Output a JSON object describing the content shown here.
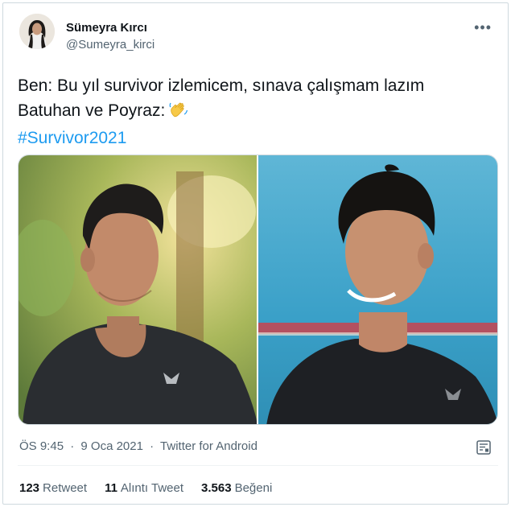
{
  "author": {
    "display_name": "Sümeyra Kırcı",
    "handle": "@Sumeyra_kirci"
  },
  "menu": {
    "more_icon": "more-horizontal-icon"
  },
  "tweet": {
    "line1": "Ben: Bu yıl survivor izlemicem, sınava çalışmam lazım",
    "line2": "Batuhan ve Poyraz:",
    "emoji": "waving-hand",
    "hashtag": "#Survivor2021"
  },
  "media": {
    "images": [
      "photo-left",
      "photo-right"
    ]
  },
  "meta": {
    "time": "ÖS 9:45",
    "separator": "·",
    "date": "9 Oca 2021",
    "source": "Twitter for Android",
    "analytics_icon": "analytics-icon"
  },
  "stats": {
    "retweets_count": "123",
    "retweets_label": "Retweet",
    "quotes_count": "11",
    "quotes_label": "Alıntı Tweet",
    "likes_count": "3.563",
    "likes_label": "Beğeni"
  },
  "colors": {
    "link": "#1d9bf0",
    "secondary_text": "#536471",
    "border": "#cfd9de"
  }
}
